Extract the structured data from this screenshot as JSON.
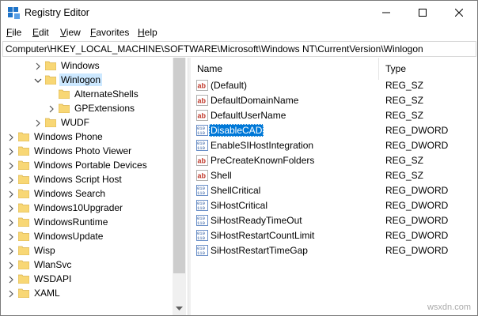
{
  "window": {
    "title": "Registry Editor"
  },
  "menu": [
    "File",
    "Edit",
    "View",
    "Favorites",
    "Help"
  ],
  "address": "Computer\\HKEY_LOCAL_MACHINE\\SOFTWARE\\Microsoft\\Windows NT\\CurrentVersion\\Winlogon",
  "tree": [
    {
      "label": "Windows",
      "indent": 3,
      "chevron": "right"
    },
    {
      "label": "Winlogon",
      "indent": 3,
      "chevron": "down",
      "selected": true
    },
    {
      "label": "AlternateShells",
      "indent": 4,
      "chevron": ""
    },
    {
      "label": "GPExtensions",
      "indent": 4,
      "chevron": "right"
    },
    {
      "label": "WUDF",
      "indent": 3,
      "chevron": "right"
    },
    {
      "label": "Windows Phone",
      "indent": 1,
      "chevron": "right"
    },
    {
      "label": "Windows Photo Viewer",
      "indent": 1,
      "chevron": "right"
    },
    {
      "label": "Windows Portable Devices",
      "indent": 1,
      "chevron": "right"
    },
    {
      "label": "Windows Script Host",
      "indent": 1,
      "chevron": "right"
    },
    {
      "label": "Windows Search",
      "indent": 1,
      "chevron": "right"
    },
    {
      "label": "Windows10Upgrader",
      "indent": 1,
      "chevron": "right"
    },
    {
      "label": "WindowsRuntime",
      "indent": 1,
      "chevron": "right"
    },
    {
      "label": "WindowsUpdate",
      "indent": 1,
      "chevron": "right"
    },
    {
      "label": "Wisp",
      "indent": 1,
      "chevron": "right"
    },
    {
      "label": "WlanSvc",
      "indent": 1,
      "chevron": "right"
    },
    {
      "label": "WSDAPI",
      "indent": 1,
      "chevron": "right"
    },
    {
      "label": "XAML",
      "indent": 1,
      "chevron": "right"
    }
  ],
  "columns": {
    "name": "Name",
    "type": "Type"
  },
  "values": [
    {
      "name": "(Default)",
      "type": "REG_SZ",
      "icon": "string-value-icon"
    },
    {
      "name": "DefaultDomainName",
      "type": "REG_SZ",
      "icon": "string-value-icon"
    },
    {
      "name": "DefaultUserName",
      "type": "REG_SZ",
      "icon": "string-value-icon"
    },
    {
      "name": "DisableCAD",
      "type": "REG_DWORD",
      "icon": "binary-value-icon",
      "selected": true
    },
    {
      "name": "EnableSIHostIntegration",
      "type": "REG_DWORD",
      "icon": "binary-value-icon"
    },
    {
      "name": "PreCreateKnownFolders",
      "type": "REG_SZ",
      "icon": "string-value-icon"
    },
    {
      "name": "Shell",
      "type": "REG_SZ",
      "icon": "string-value-icon"
    },
    {
      "name": "ShellCritical",
      "type": "REG_DWORD",
      "icon": "binary-value-icon"
    },
    {
      "name": "SiHostCritical",
      "type": "REG_DWORD",
      "icon": "binary-value-icon"
    },
    {
      "name": "SiHostReadyTimeOut",
      "type": "REG_DWORD",
      "icon": "binary-value-icon"
    },
    {
      "name": "SiHostRestartCountLimit",
      "type": "REG_DWORD",
      "icon": "binary-value-icon"
    },
    {
      "name": "SiHostRestartTimeGap",
      "type": "REG_DWORD",
      "icon": "binary-value-icon"
    }
  ],
  "watermark": "wsxdn.com",
  "colors": {
    "selection": "#0078d7",
    "folder": "#f8d775"
  }
}
